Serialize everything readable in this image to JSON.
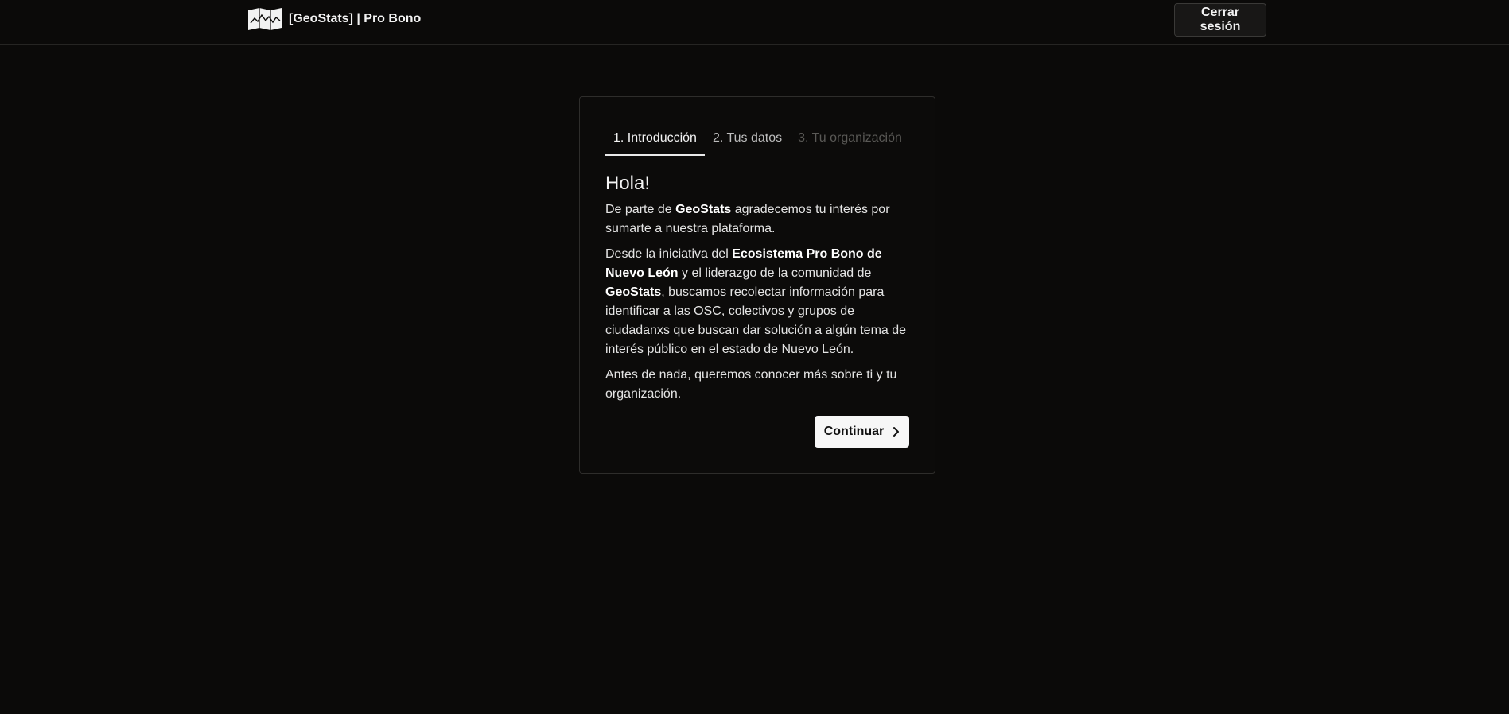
{
  "header": {
    "brand_text": "[GeoStats] | Pro Bono",
    "logo_icon": "map-icon",
    "logout_label": "Cerrar sesión"
  },
  "wizard": {
    "tabs": [
      {
        "label": "1. Introducción",
        "state": "active"
      },
      {
        "label": "2. Tus datos",
        "state": "available"
      },
      {
        "label": "3. Tu organización",
        "state": "disabled"
      }
    ],
    "heading": "Hola!",
    "paragraph1": {
      "t1": "De parte de ",
      "b1": "GeoStats",
      "t2": " agradecemos tu interés por sumarte a nuestra plataforma."
    },
    "paragraph2": {
      "t1": "Desde la iniciativa del ",
      "b1": "Ecosistema Pro Bono de Nuevo León",
      "t2": " y el liderazgo de la comunidad de ",
      "b2": "GeoStats",
      "t3": ", buscamos recolectar información para identificar a las OSC, colectivos y grupos de ciudadanxs que buscan dar solución a algún tema de interés público en el estado de Nuevo León."
    },
    "paragraph3": "Antes de nada, queremos conocer más sobre ti y tu organización.",
    "continue_label": "Continuar",
    "continue_icon": "chevron-right-icon"
  },
  "colors": {
    "background": "#0b0a09",
    "card_border": "#2e2d2b",
    "primary_button": "#f7f7f7",
    "text": "#ececec",
    "disabled_tab": "#5a5956"
  }
}
